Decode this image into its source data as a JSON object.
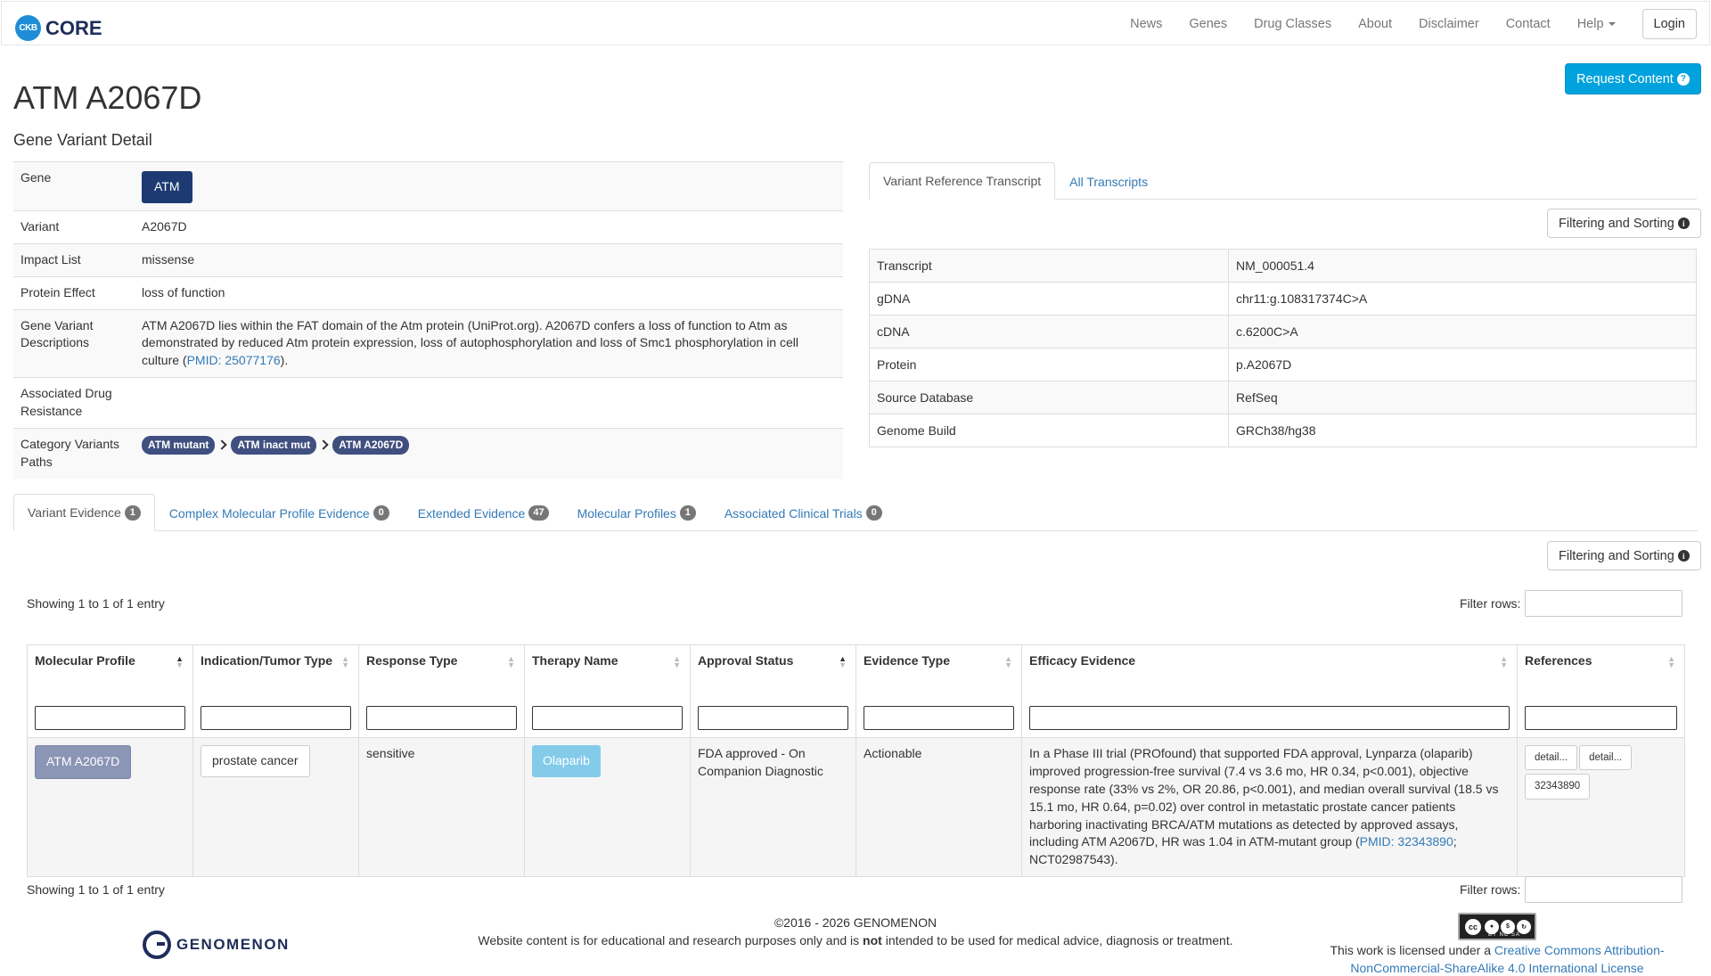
{
  "navbar": {
    "logo_text": "CKB",
    "brand": "CORE",
    "links": [
      "News",
      "Genes",
      "Drug Classes",
      "About",
      "Disclaimer",
      "Contact",
      "Help"
    ],
    "login": "Login"
  },
  "header": {
    "title": "ATM A2067D",
    "subtitle": "Gene Variant Detail",
    "request_button": "Request Content",
    "request_icon": "?"
  },
  "detail": {
    "gene_label": "Gene",
    "gene_value": "ATM",
    "variant_label": "Variant",
    "variant_value": "A2067D",
    "impact_label": "Impact List",
    "impact_value": "missense",
    "protein_effect_label": "Protein Effect",
    "protein_effect_value": "loss of function",
    "descriptions_label": "Gene Variant Descriptions",
    "description_text": "ATM A2067D lies within the FAT domain of the Atm protein (UniProt.org). A2067D confers a loss of function to Atm as demonstrated by reduced Atm protein expression, loss of autophosphorylation and loss of Smc1 phosphorylation in cell culture (",
    "description_pmid": "PMID: 25077176",
    "description_end": ").",
    "drug_resistance_label": "Associated Drug Resistance",
    "drug_resistance_value": "",
    "category_label": "Category Variants Paths",
    "category_paths": [
      "ATM mutant",
      "ATM inact mut",
      "ATM A2067D"
    ]
  },
  "transcript_tabs": {
    "tab1": "Variant Reference Transcript",
    "tab2": "All Transcripts"
  },
  "filter_sorting_label": "Filtering and Sorting",
  "info_icon": "i",
  "transcript": [
    {
      "label": "Transcript",
      "value": "NM_000051.4"
    },
    {
      "label": "gDNA",
      "value": "chr11:g.108317374C>A"
    },
    {
      "label": "cDNA",
      "value": "c.6200C>A"
    },
    {
      "label": "Protein",
      "value": "p.A2067D"
    },
    {
      "label": "Source Database",
      "value": "RefSeq"
    },
    {
      "label": "Genome Build",
      "value": "GRCh38/hg38"
    }
  ],
  "evidence_tabs": [
    {
      "label": "Variant Evidence",
      "count": "1"
    },
    {
      "label": "Complex Molecular Profile Evidence",
      "count": "0"
    },
    {
      "label": "Extended Evidence",
      "count": "47"
    },
    {
      "label": "Molecular Profiles",
      "count": "1"
    },
    {
      "label": "Associated Clinical Trials",
      "count": "0"
    }
  ],
  "table_info": "Showing 1 to 1 of 1 entry",
  "filter_rows_label": "Filter rows:",
  "columns": [
    "Molecular Profile",
    "Indication/Tumor Type",
    "Response Type",
    "Therapy Name",
    "Approval Status",
    "Evidence Type",
    "Efficacy Evidence",
    "References"
  ],
  "row": {
    "molecular_profile": "ATM A2067D",
    "indication": "prostate cancer",
    "response_type": "sensitive",
    "therapy": "Olaparib",
    "approval_status": "FDA approved - On Companion Diagnostic",
    "evidence_type": "Actionable",
    "efficacy_text": "In a Phase III trial (PROfound) that supported FDA approval, Lynparza (olaparib) improved progression-free survival (7.4 vs 3.6 mo, HR 0.34, p<0.001), objective response rate (33% vs 2%, OR 20.86, p<0.001), and median overall survival (18.5 vs 15.1 mo, HR 0.64, p=0.02) over control in metastatic prostate cancer patients harboring inactivating BRCA/ATM mutations as detected by approved assays, including ATM A2067D, HR was 1.04 in ATM-mutant group (",
    "efficacy_pmid": "PMID: 32343890",
    "efficacy_end": "; NCT02987543).",
    "ref_buttons": [
      "detail...",
      "detail...",
      "32343890"
    ]
  },
  "footer": {
    "copyright": "©2016 - 2026 GENOMENON",
    "disclaimer_a": "Website content is for educational and research purposes only and is ",
    "disclaimer_bold": "not",
    "disclaimer_b": " intended to be used for medical advice, diagnosis or treatment.",
    "logo_text": "GENOMENON",
    "cc_text": "cc",
    "cc_sub": "BY NC SA",
    "license_prefix": "This work is licensed under a ",
    "license_link": "Creative Commons Attribution-NonCommercial-ShareAlike 4.0 International License"
  }
}
